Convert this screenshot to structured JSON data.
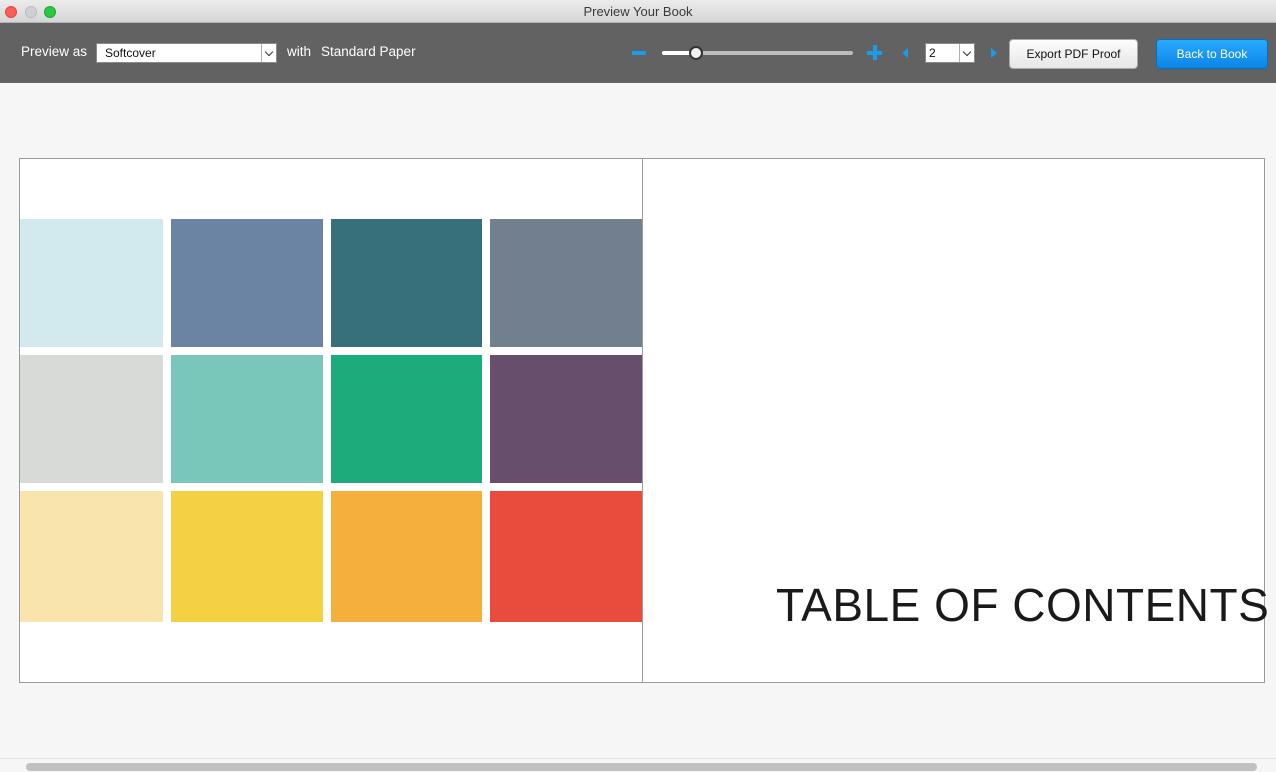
{
  "window": {
    "title": "Preview Your Book"
  },
  "toolbar": {
    "preview_as_label": "Preview as",
    "cover_value": "Softcover",
    "with_label": "with",
    "paper_label": "Standard Paper",
    "zoom": {
      "level": 0.18
    },
    "page_value": "2",
    "export_label": "Export PDF Proof",
    "back_label": "Back to Book"
  },
  "colors": {
    "accent": "#1a9bec",
    "toolbar_bg": "#626262",
    "swatches": [
      "#d2eaee",
      "#6c84a3",
      "#37707b",
      "#717f8f",
      "#d7dad7",
      "#79c6ba",
      "#1cac7c",
      "#674e6d",
      "#f9e4ad",
      "#f4d043",
      "#f5af3c",
      "#e94b3d"
    ]
  },
  "right_page": {
    "heading": "TABLE OF CONTENTS"
  }
}
